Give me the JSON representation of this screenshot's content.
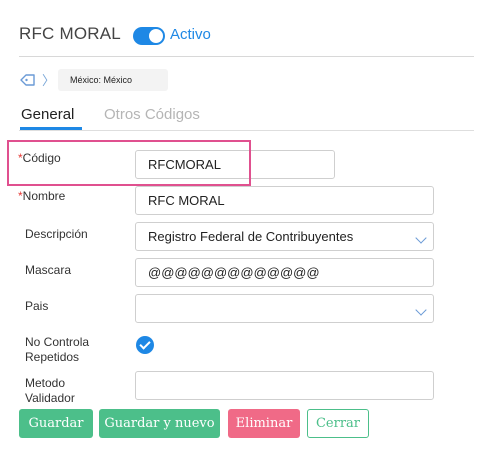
{
  "header": {
    "title": "RFC MORAL",
    "status_toggle": {
      "on": true,
      "label": "Activo"
    }
  },
  "breadcrumb": {
    "icon": "tag-icon",
    "separator_icon": "chevron-right-icon",
    "location": "México: México"
  },
  "tabs": [
    {
      "label": "General",
      "active": true
    },
    {
      "label": "Otros Códigos",
      "active": false
    }
  ],
  "form": {
    "codigo": {
      "label": "Código",
      "required": true,
      "value": "RFCMORAL"
    },
    "nombre": {
      "label": "Nombre",
      "required": true,
      "value": "RFC MORAL"
    },
    "descripcion": {
      "label": "Descripción",
      "value": "Registro Federal de Contribuyentes"
    },
    "mascara": {
      "label": "Mascara",
      "value": "@@@@@@@@@@@@@"
    },
    "pais": {
      "label": "Pais",
      "value": ""
    },
    "no_controla_repetidos": {
      "label_line1": "No Controla",
      "label_line2": "Repetidos",
      "checked": true
    },
    "metodo_validador": {
      "label_line1": "Metodo",
      "label_line2": "Validador",
      "value": ""
    }
  },
  "buttons": {
    "guardar": "Guardar",
    "guardar_nuevo": "Guardar y nuevo",
    "eliminar": "Eliminar",
    "cerrar": "Cerrar"
  },
  "colors": {
    "accent": "#1e88e5",
    "success": "#4cbf8a",
    "danger": "#f06a87",
    "highlight": "#e0508f",
    "required": "#e53935"
  }
}
